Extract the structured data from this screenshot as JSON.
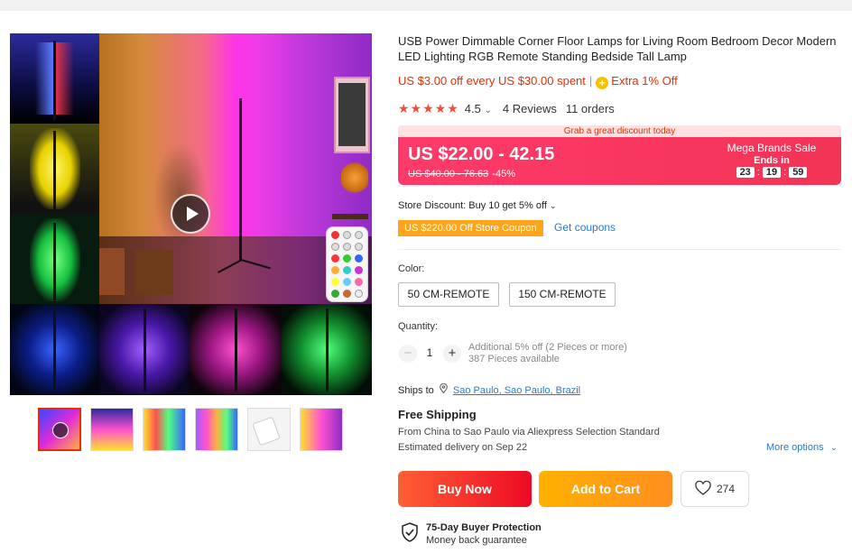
{
  "product": {
    "title": "USB Power Dimmable Corner Floor Lamps for Living Room Bedroom Decor Modern LED Lighting RGB Remote Standing Bedside Tall Lamp",
    "promo_text": "US $3.00 off every US $30.00 spent",
    "promo_separator": "|",
    "extra_off": "Extra 1% Off",
    "stars": "★★★★★",
    "rating": "4.5",
    "reviews": "4 Reviews",
    "orders": "11 orders"
  },
  "price": {
    "banner": "Grab a great discount today",
    "current": "US $22.00 - 42.15",
    "original": "US $40.00 - 76.63",
    "discount": "-45%",
    "sale_name": "Mega Brands Sale",
    "ends_label": "Ends in",
    "timer": {
      "h": "23",
      "m": "19",
      "s": "59",
      "sep": ":"
    }
  },
  "store": {
    "discount_text": "Store Discount: Buy 10 get 5% off",
    "coupon_label": "US $220.00 Off Store Coupon",
    "get_coupons": "Get coupons"
  },
  "options": {
    "color_label": "Color:",
    "colors": [
      "50 CM-REMOTE",
      "150 CM-REMOTE"
    ]
  },
  "quantity": {
    "label": "Quantity:",
    "value": "1",
    "minus": "−",
    "plus": "+",
    "additional": "Additional 5% off (2 Pieces or more)",
    "available": "387 Pieces available"
  },
  "shipping": {
    "ships_to_label": "Ships to",
    "destination": "Sao Paulo, Sao Paulo, Brazil",
    "free_shipping": "Free Shipping",
    "from_line": "From China to Sao Paulo via Aliexpress Selection Standard",
    "estimated": "Estimated delivery on Sep 22",
    "more_options": "More options"
  },
  "actions": {
    "buy_now": "Buy Now",
    "add_to_cart": "Add to Cart",
    "wishlist_count": "274"
  },
  "protection": {
    "title": "75-Day Buyer Protection",
    "subtitle": "Money back guarantee"
  },
  "colors": {
    "accent_red": "#e62e04",
    "link_blue": "#2c79c7",
    "coupon_orange": "#ffa51b",
    "price_box": "#f23456"
  },
  "icons": [
    "play-icon",
    "coin-icon",
    "chevron-down-icon",
    "location-pin-icon",
    "heart-icon",
    "shield-check-icon"
  ]
}
